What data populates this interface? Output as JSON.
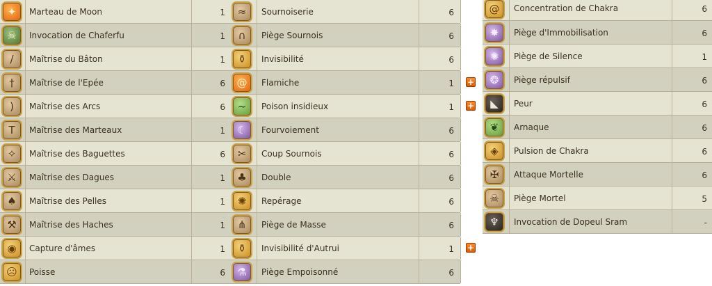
{
  "columns": [
    {
      "spells": [
        {
          "name": "Marteau de Moon",
          "level": "1",
          "icon": "hammer-icon",
          "glyph": "✦"
        },
        {
          "name": "Invocation de Chaferfu",
          "level": "1",
          "icon": "skull-icon",
          "glyph": "☠"
        },
        {
          "name": "Maîtrise du Bâton",
          "level": "1",
          "icon": "staff-icon",
          "glyph": "/"
        },
        {
          "name": "Maîtrise de l'Epée",
          "level": "6",
          "icon": "sword-icon",
          "glyph": "†"
        },
        {
          "name": "Maîtrise des Arcs",
          "level": "6",
          "icon": "bow-icon",
          "glyph": ")"
        },
        {
          "name": "Maîtrise des Marteaux",
          "level": "1",
          "icon": "hammer-icon",
          "glyph": "T"
        },
        {
          "name": "Maîtrise des Baguettes",
          "level": "6",
          "icon": "wand-icon",
          "glyph": "✧"
        },
        {
          "name": "Maîtrise des Dagues",
          "level": "1",
          "icon": "dagger-icon",
          "glyph": "⚔"
        },
        {
          "name": "Maîtrise des Pelles",
          "level": "1",
          "icon": "shovel-icon",
          "glyph": "♠"
        },
        {
          "name": "Maîtrise des Haches",
          "level": "1",
          "icon": "axe-icon",
          "glyph": "⚒"
        },
        {
          "name": "Capture d'âmes",
          "level": "1",
          "icon": "soul-capture-icon",
          "glyph": "◉"
        },
        {
          "name": "Poisse",
          "level": "6",
          "icon": "bad-luck-icon",
          "glyph": "☹"
        }
      ]
    },
    {
      "spells": [
        {
          "name": "Sournoiserie",
          "level": "6",
          "icon": "sneak-icon",
          "glyph": "≈",
          "plus": false
        },
        {
          "name": "Piège Sournois",
          "level": "6",
          "icon": "trap-icon",
          "glyph": "∩",
          "plus": false
        },
        {
          "name": "Invisibilité",
          "level": "6",
          "icon": "invisibility-icon",
          "glyph": "⚱",
          "plus": false
        },
        {
          "name": "Flamiche",
          "level": "1",
          "icon": "flame-spiral-icon",
          "glyph": "@",
          "plus": true
        },
        {
          "name": "Poison insidieux",
          "level": "1",
          "icon": "poison-icon",
          "glyph": "~",
          "plus": true
        },
        {
          "name": "Fourvoiement",
          "level": "6",
          "icon": "mask-icon",
          "glyph": "☾",
          "plus": false
        },
        {
          "name": "Coup Sournois",
          "level": "6",
          "icon": "stab-icon",
          "glyph": "✂",
          "plus": false
        },
        {
          "name": "Double",
          "level": "6",
          "icon": "double-icon",
          "glyph": "♣",
          "plus": false
        },
        {
          "name": "Repérage",
          "level": "6",
          "icon": "detect-icon",
          "glyph": "✺",
          "plus": false
        },
        {
          "name": "Piège de Masse",
          "level": "6",
          "icon": "mass-trap-icon",
          "glyph": "⋔",
          "plus": false
        },
        {
          "name": "Invisibilité d'Autrui",
          "level": "1",
          "icon": "ally-invisibility-icon",
          "glyph": "⚱",
          "plus": true
        },
        {
          "name": "Piège Empoisonné",
          "level": "6",
          "icon": "poison-trap-icon",
          "glyph": "⚗",
          "plus": false
        }
      ]
    },
    {
      "spells": [
        {
          "name": "Concentration de Chakra",
          "level": "6",
          "icon": "chakra-spiral-icon",
          "glyph": "@"
        },
        {
          "name": "Piège d'Immobilisation",
          "level": "6",
          "icon": "immobilize-trap-icon",
          "glyph": "✸"
        },
        {
          "name": "Piège de Silence",
          "level": "1",
          "icon": "silence-trap-icon",
          "glyph": "✺"
        },
        {
          "name": "Piège répulsif",
          "level": "6",
          "icon": "repel-trap-icon",
          "glyph": "❂"
        },
        {
          "name": "Peur",
          "level": "6",
          "icon": "fear-icon",
          "glyph": "◣"
        },
        {
          "name": "Arnaque",
          "level": "6",
          "icon": "scam-icon",
          "glyph": "❦"
        },
        {
          "name": "Pulsion de Chakra",
          "level": "6",
          "icon": "chakra-pulse-icon",
          "glyph": "◈"
        },
        {
          "name": "Attaque Mortelle",
          "level": "6",
          "icon": "deadly-attack-icon",
          "glyph": "✠"
        },
        {
          "name": "Piège Mortel",
          "level": "5",
          "icon": "deadly-trap-icon",
          "glyph": "☠"
        },
        {
          "name": "Invocation de Dopeul Sram",
          "level": "-",
          "icon": "dopple-icon",
          "glyph": "♆"
        }
      ]
    }
  ],
  "plus_label": "+",
  "colors": {
    "row_light": "#e5e3d2",
    "row_dark": "#d2d0be",
    "plus_button": "#e05a00"
  }
}
